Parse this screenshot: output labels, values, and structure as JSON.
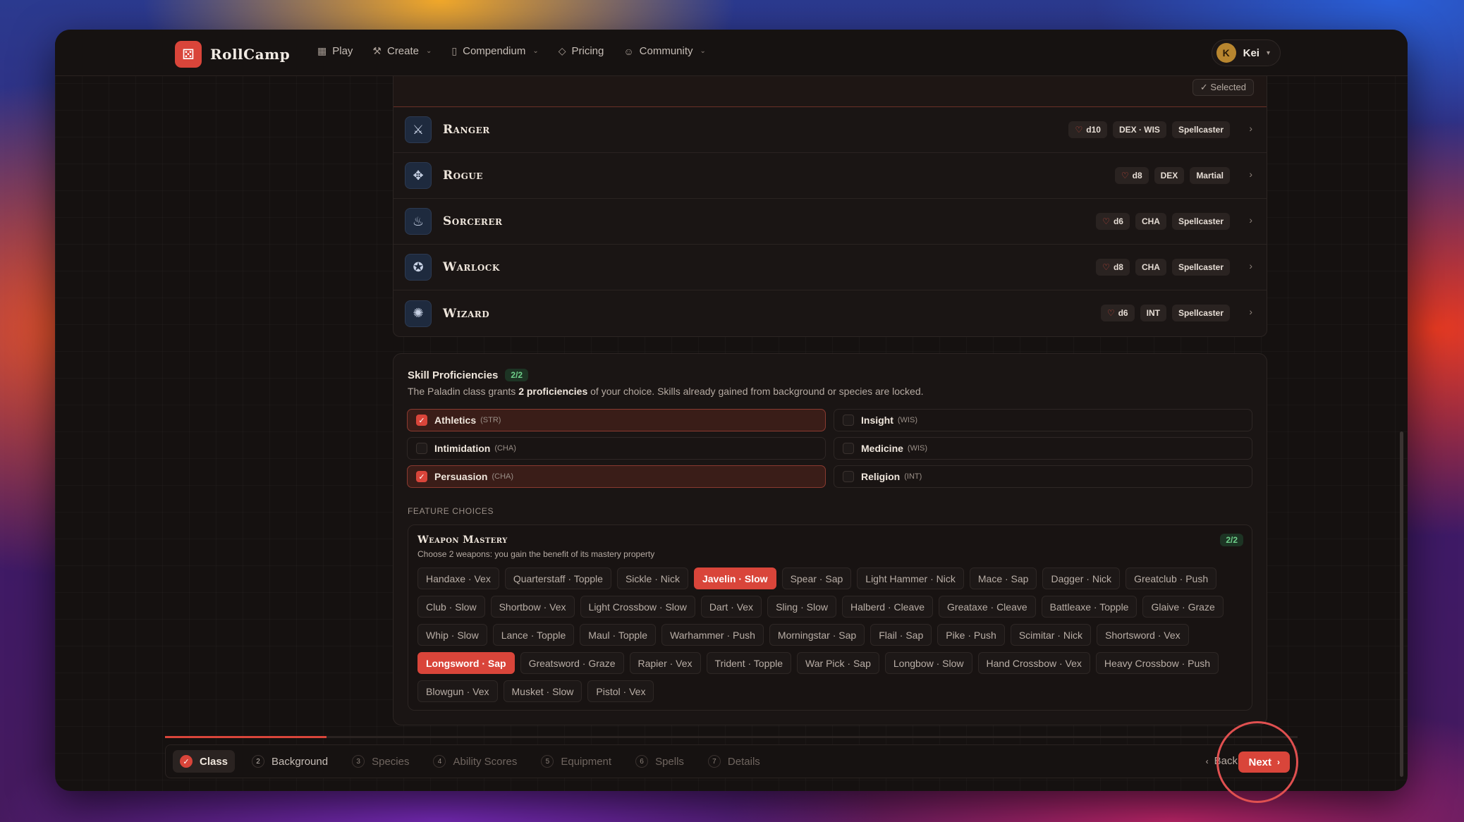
{
  "brand": {
    "logo_icon": "dice-icon",
    "name": "RollCamp",
    "accent": "#d9453a"
  },
  "nav": [
    {
      "label": "Play",
      "icon": "grid-icon",
      "dropdown": false
    },
    {
      "label": "Create",
      "icon": "anvil-icon",
      "dropdown": true
    },
    {
      "label": "Compendium",
      "icon": "book-icon",
      "dropdown": true
    },
    {
      "label": "Pricing",
      "icon": "gem-icon",
      "dropdown": false
    },
    {
      "label": "Community",
      "icon": "users-icon",
      "dropdown": true
    }
  ],
  "user": {
    "initial": "K",
    "name": "Kei"
  },
  "class_list": {
    "selected_label": "✓ Selected",
    "classes": [
      {
        "name": "Ranger",
        "icon": "ranger-icon",
        "hit_die": "d10",
        "abilities": "DEX · WIS",
        "type": "Spellcaster"
      },
      {
        "name": "Rogue",
        "icon": "rogue-icon",
        "hit_die": "d8",
        "abilities": "DEX",
        "type": "Martial"
      },
      {
        "name": "Sorcerer",
        "icon": "sorcerer-icon",
        "hit_die": "d6",
        "abilities": "CHA",
        "type": "Spellcaster"
      },
      {
        "name": "Warlock",
        "icon": "warlock-icon",
        "hit_die": "d8",
        "abilities": "CHA",
        "type": "Spellcaster"
      },
      {
        "name": "Wizard",
        "icon": "wizard-icon",
        "hit_die": "d6",
        "abilities": "INT",
        "type": "Spellcaster"
      }
    ]
  },
  "skills": {
    "title": "Skill Proficiencies",
    "count": "2/2",
    "desc_prefix": "The Paladin class grants ",
    "desc_bold": "2 proficiencies",
    "desc_suffix": " of your choice. Skills already gained from background or species are locked.",
    "items": [
      {
        "name": "Athletics",
        "abbr": "(STR)",
        "checked": true
      },
      {
        "name": "Insight",
        "abbr": "(WIS)",
        "checked": false
      },
      {
        "name": "Intimidation",
        "abbr": "(CHA)",
        "checked": false
      },
      {
        "name": "Medicine",
        "abbr": "(WIS)",
        "checked": false
      },
      {
        "name": "Persuasion",
        "abbr": "(CHA)",
        "checked": true
      },
      {
        "name": "Religion",
        "abbr": "(INT)",
        "checked": false
      }
    ]
  },
  "features": {
    "label": "FEATURE CHOICES",
    "mastery": {
      "title": "Weapon Mastery",
      "count": "2/2",
      "desc": "Choose 2 weapons: you gain the benefit of its mastery property",
      "rows": [
        [
          {
            "label": "Handaxe · Vex",
            "selected": false
          },
          {
            "label": "Quarterstaff · Topple",
            "selected": false
          },
          {
            "label": "Sickle · Nick",
            "selected": false
          },
          {
            "label": "Javelin · Slow",
            "selected": true
          },
          {
            "label": "Spear · Sap",
            "selected": false
          },
          {
            "label": "Light Hammer · Nick",
            "selected": false
          },
          {
            "label": "Mace · Sap",
            "selected": false
          },
          {
            "label": "Dagger · Nick",
            "selected": false
          },
          {
            "label": "Greatclub · Push",
            "selected": false
          }
        ],
        [
          {
            "label": "Club · Slow",
            "selected": false
          },
          {
            "label": "Shortbow · Vex",
            "selected": false
          },
          {
            "label": "Light Crossbow · Slow",
            "selected": false
          },
          {
            "label": "Dart · Vex",
            "selected": false
          },
          {
            "label": "Sling · Slow",
            "selected": false
          },
          {
            "label": "Halberd · Cleave",
            "selected": false
          },
          {
            "label": "Greataxe · Cleave",
            "selected": false
          },
          {
            "label": "Battleaxe · Topple",
            "selected": false
          },
          {
            "label": "Glaive · Graze",
            "selected": false
          }
        ],
        [
          {
            "label": "Whip · Slow",
            "selected": false
          },
          {
            "label": "Lance · Topple",
            "selected": false
          },
          {
            "label": "Maul · Topple",
            "selected": false
          },
          {
            "label": "Warhammer · Push",
            "selected": false
          },
          {
            "label": "Morningstar · Sap",
            "selected": false
          },
          {
            "label": "Flail · Sap",
            "selected": false
          },
          {
            "label": "Pike · Push",
            "selected": false
          },
          {
            "label": "Scimitar · Nick",
            "selected": false
          },
          {
            "label": "Shortsword · Vex",
            "selected": false
          }
        ],
        [
          {
            "label": "Longsword · Sap",
            "selected": true
          },
          {
            "label": "Greatsword · Graze",
            "selected": false
          },
          {
            "label": "Rapier · Vex",
            "selected": false
          },
          {
            "label": "Trident · Topple",
            "selected": false
          },
          {
            "label": "War Pick · Sap",
            "selected": false
          },
          {
            "label": "Longbow · Slow",
            "selected": false
          },
          {
            "label": "Hand Crossbow · Vex",
            "selected": false
          },
          {
            "label": "Heavy Crossbow · Push",
            "selected": false
          }
        ],
        [
          {
            "label": "Blowgun · Vex",
            "selected": false
          },
          {
            "label": "Musket · Slow",
            "selected": false
          },
          {
            "label": "Pistol · Vex",
            "selected": false
          }
        ]
      ]
    }
  },
  "stepper": {
    "progress_fraction": 0.1429,
    "steps": [
      {
        "num": "1",
        "label": "Class",
        "state": "active"
      },
      {
        "num": "2",
        "label": "Background",
        "state": "next"
      },
      {
        "num": "3",
        "label": "Species",
        "state": "pending"
      },
      {
        "num": "4",
        "label": "Ability Scores",
        "state": "pending"
      },
      {
        "num": "5",
        "label": "Equipment",
        "state": "pending"
      },
      {
        "num": "6",
        "label": "Spells",
        "state": "pending"
      },
      {
        "num": "7",
        "label": "Details",
        "state": "pending"
      }
    ],
    "back_label": "Back",
    "next_label": "Next"
  }
}
